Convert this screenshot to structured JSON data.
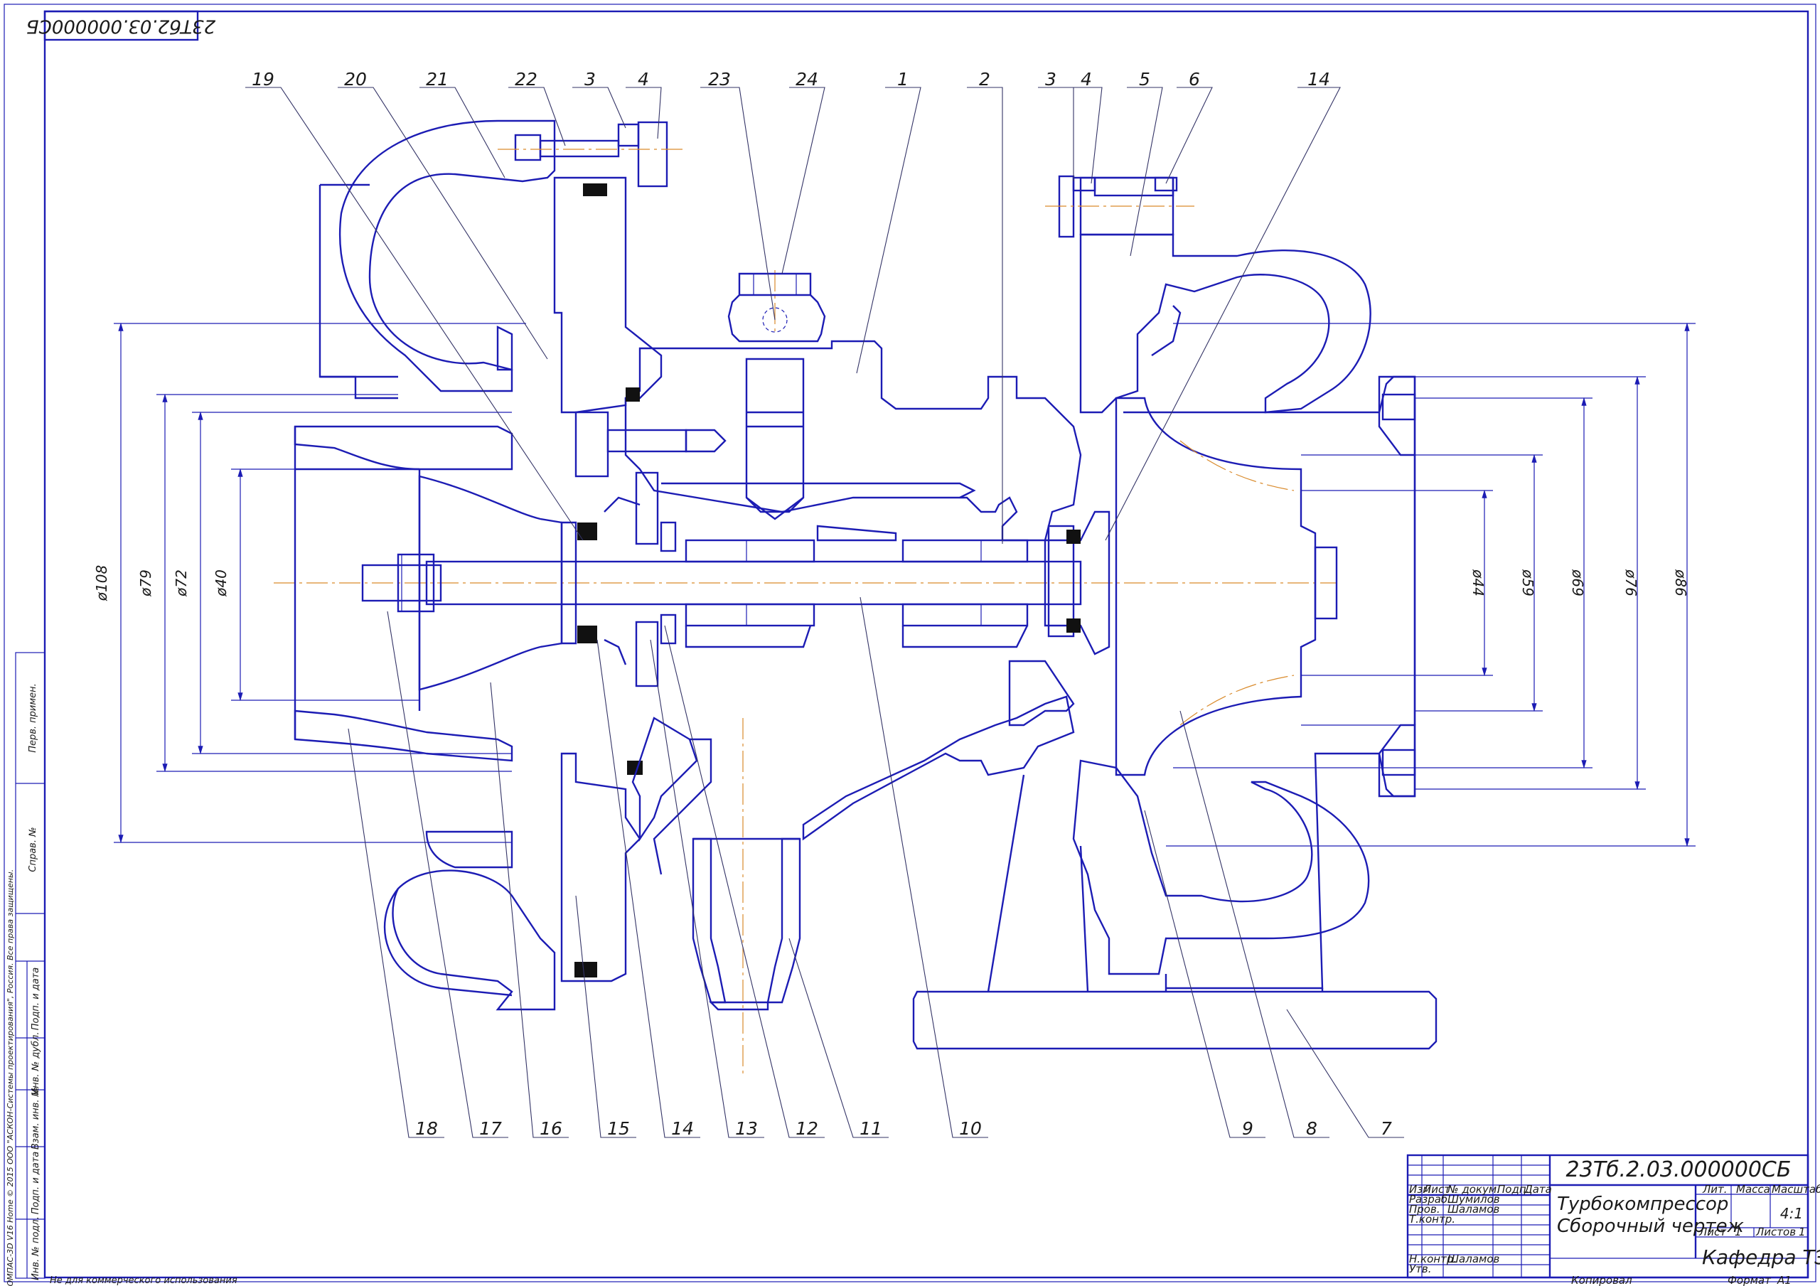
{
  "drawing": {
    "code": "23Тб.2.03.000000СБ",
    "code_corner": "23Тб2.03.000000СБ",
    "title_line1": "Турбокомпрессор",
    "title_line2": "Сборочный чертеж",
    "department": "Кафедра ТЭУ",
    "scale": "4:1",
    "sheet": "1",
    "sheets": "1",
    "format": "А1"
  },
  "title_block": {
    "labels": {
      "izm": "Изм",
      "list": "Лист",
      "ndoc": "№ докум.",
      "podp": "Подп.",
      "data": "Дата",
      "razrab": "Разраб.",
      "prov": "Пров.",
      "tkontr": "Т.контр.",
      "nkontr": "Н.контр.",
      "utv": "Утв.",
      "lit": "Лит.",
      "massa": "Масса",
      "masshtab": "Масштаб",
      "list_label": "Лист",
      "listov_label": "Листов",
      "kopiroval": "Копировал",
      "format_label": "Формат"
    },
    "people": {
      "razrab": "Шумилов",
      "prov": "Шаламов",
      "nkontr": "Шаламов"
    }
  },
  "side_stamp": {
    "perv_primen": "Перв. примен.",
    "sprav": "Справ. №",
    "podp_data_1": "Подп. и дата",
    "inv_dubl": "Инв. № дубл.",
    "vzam_inv": "Взам. инв. №",
    "podp_data_2": "Подп. и дата",
    "inv_podl": "Инв. № подл.",
    "copyright": "КОМПАС-3D V16 Home © 2015 ООО \"АСКОН-Системы проектирования\", Россия. Все права защищены.",
    "noncommercial": "Не для коммерческого использования"
  },
  "part_labels": {
    "top": [
      "19",
      "20",
      "21",
      "22",
      "3",
      "4",
      "23",
      "24",
      "1",
      "2",
      "3",
      "4",
      "5",
      "6",
      "14"
    ],
    "bottom": [
      "18",
      "17",
      "16",
      "15",
      "14",
      "13",
      "12",
      "11",
      "10",
      "9",
      "8",
      "7"
    ]
  },
  "dimensions": {
    "left": [
      "ø108",
      "ø79",
      "ø72",
      "ø40"
    ],
    "right": [
      "ø44",
      "ø59",
      "ø69",
      "ø76",
      "ø86"
    ]
  }
}
